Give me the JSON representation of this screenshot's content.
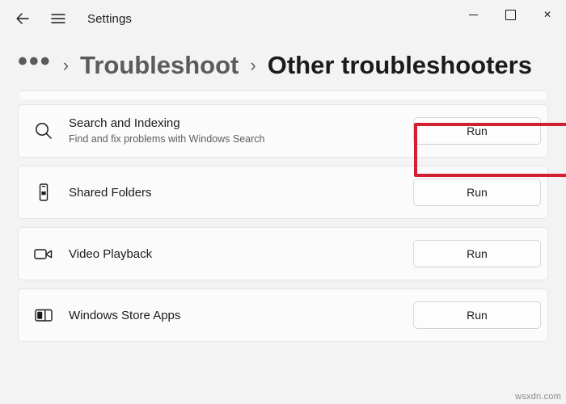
{
  "window": {
    "title": "Settings",
    "back_icon": "back-arrow-icon",
    "menu_icon": "hamburger-menu-icon",
    "minimize_label": "",
    "maximize_label": "",
    "close_label": "✕"
  },
  "breadcrumb": {
    "overflow": "•••",
    "separator": "›",
    "parent": "Troubleshoot",
    "current": "Other troubleshooters"
  },
  "troubleshooters": [
    {
      "icon": "magnifier-icon",
      "title": "Search and Indexing",
      "subtitle": "Find and fix problems with Windows Search",
      "button": "Run",
      "highlighted": true
    },
    {
      "icon": "phone-folder-icon",
      "title": "Shared Folders",
      "subtitle": "",
      "button": "Run",
      "highlighted": false
    },
    {
      "icon": "video-camera-icon",
      "title": "Video Playback",
      "subtitle": "",
      "button": "Run",
      "highlighted": false
    },
    {
      "icon": "store-apps-icon",
      "title": "Windows Store Apps",
      "subtitle": "",
      "button": "Run",
      "highlighted": false
    }
  ],
  "watermark": "wsxdn.com",
  "colors": {
    "accent_highlight": "#d32030",
    "card_bg": "#fbfbfb",
    "page_bg": "#f3f3f3",
    "text_primary": "#1b1b1b",
    "text_secondary": "#5d5d5d"
  }
}
